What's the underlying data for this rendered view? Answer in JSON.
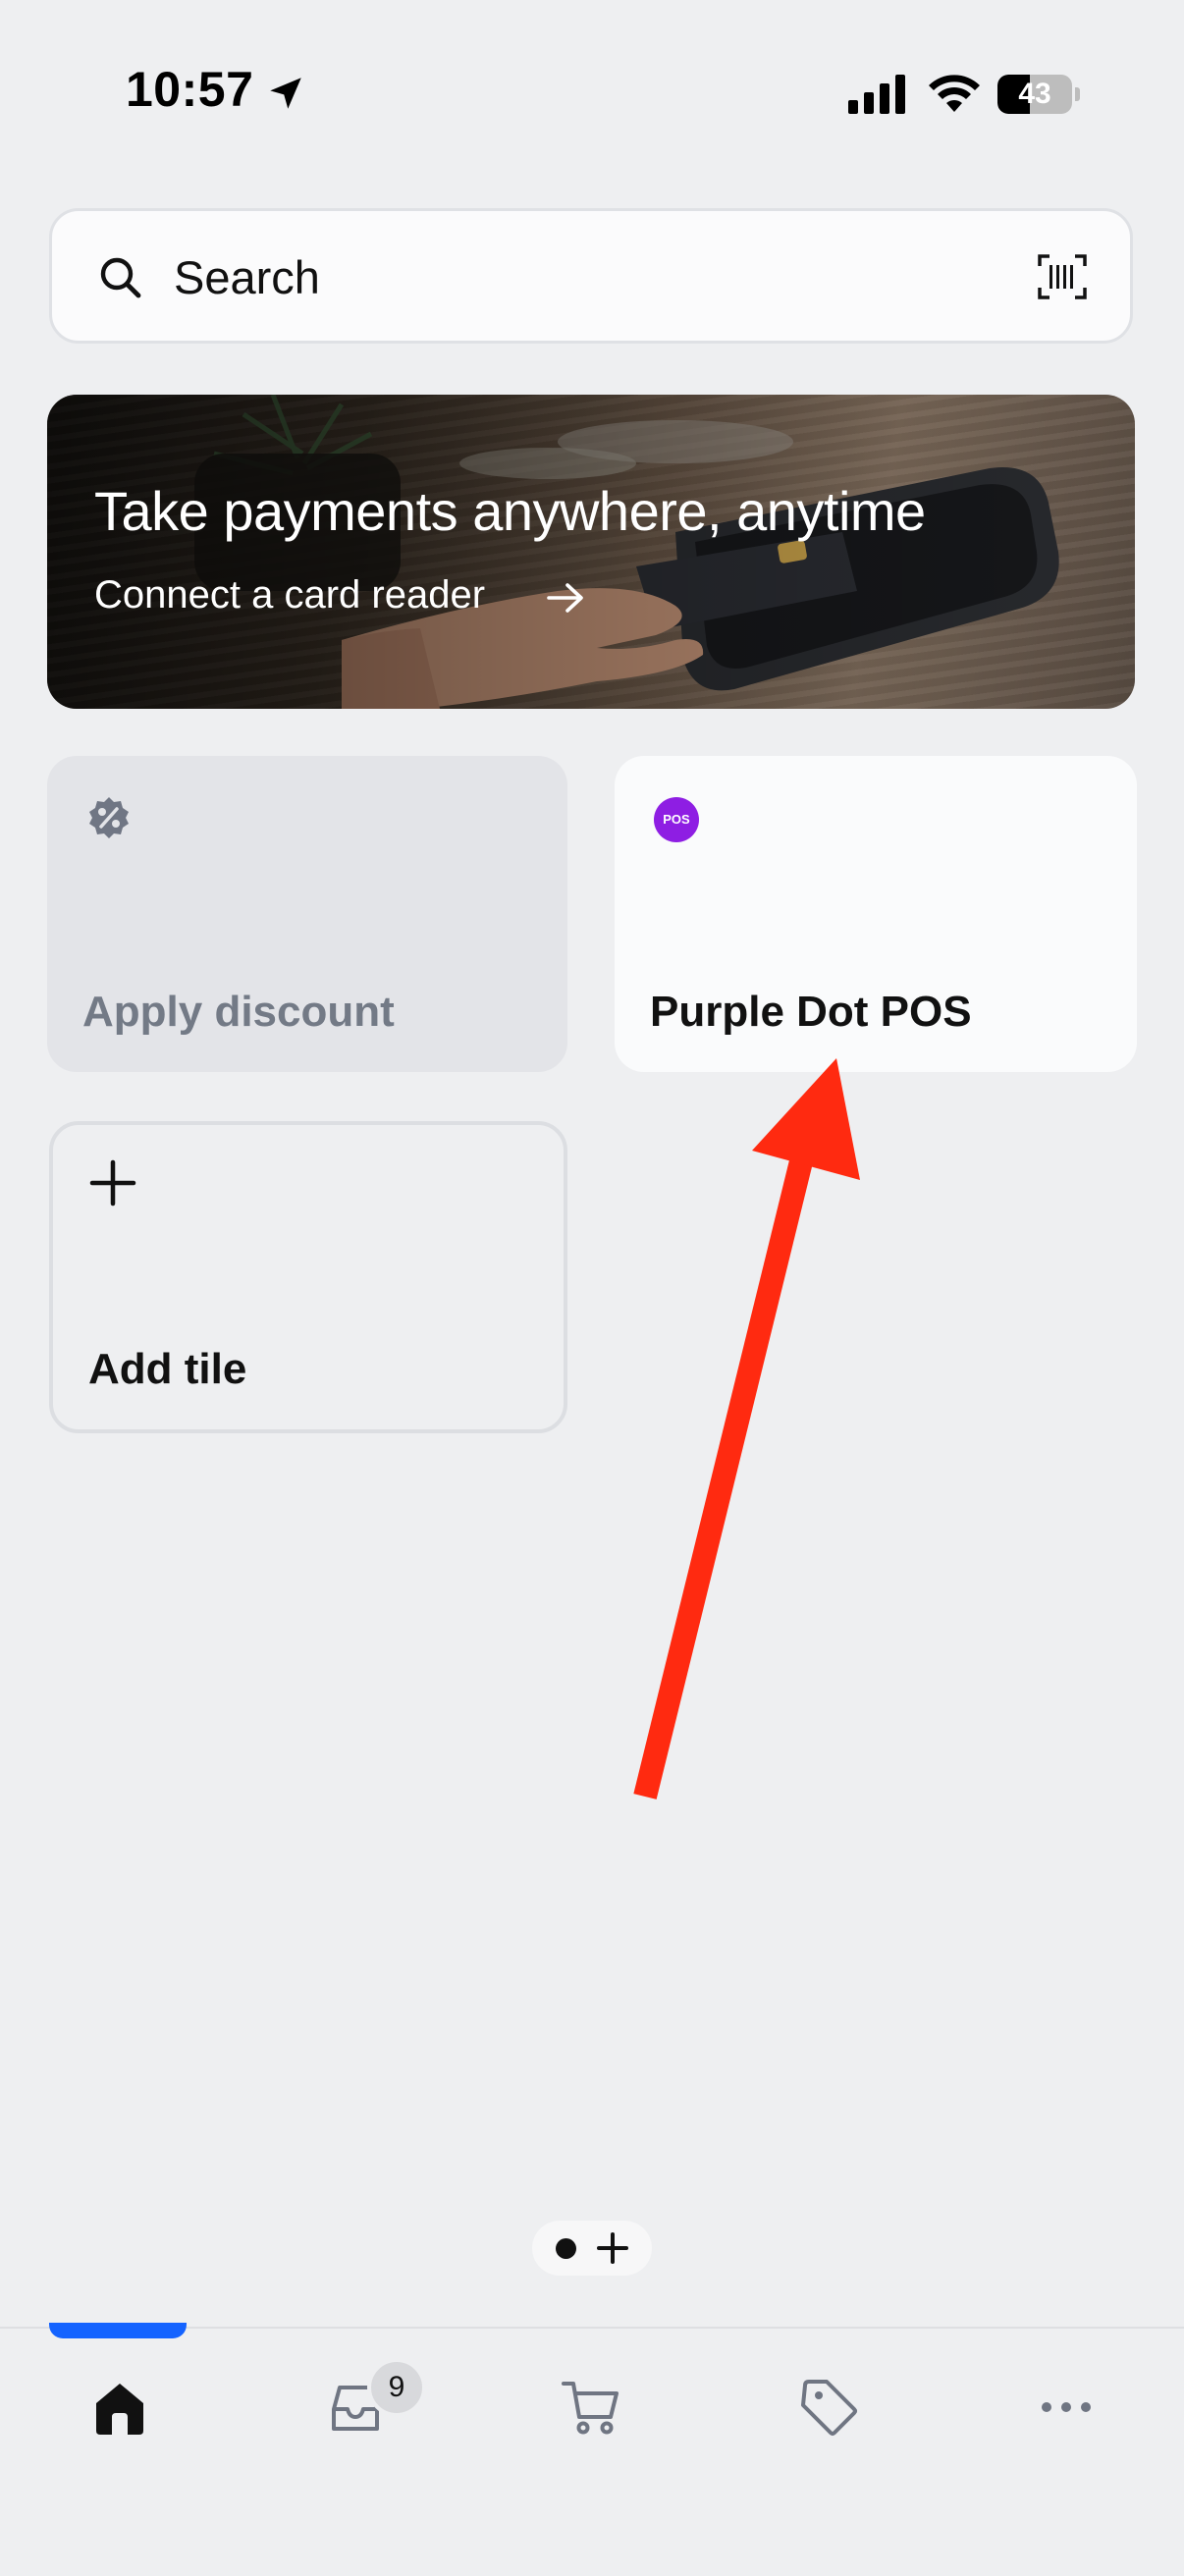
{
  "status_bar": {
    "time": "10:57",
    "battery_level": "43"
  },
  "search": {
    "label": "Search"
  },
  "banner": {
    "title": "Take payments anywhere, anytime",
    "link_label": "Connect a card reader"
  },
  "tiles": [
    {
      "label": "Apply discount",
      "icon": "percent-badge-icon"
    },
    {
      "label": "Purple Dot POS",
      "icon": "pos-app-icon",
      "icon_text": "POS"
    },
    {
      "label": "Add tile",
      "icon": "plus-icon"
    }
  ],
  "tabbar": {
    "items": [
      {
        "name": "home",
        "icon": "home-icon",
        "active": true
      },
      {
        "name": "inbox",
        "icon": "inbox-icon",
        "badge": "9"
      },
      {
        "name": "cart",
        "icon": "cart-icon"
      },
      {
        "name": "products",
        "icon": "tag-icon"
      },
      {
        "name": "more",
        "icon": "more-icon"
      }
    ]
  },
  "colors": {
    "accent": "#1463ff",
    "pos_brand": "#8e1ee3",
    "annotation": "#ff2a10"
  }
}
